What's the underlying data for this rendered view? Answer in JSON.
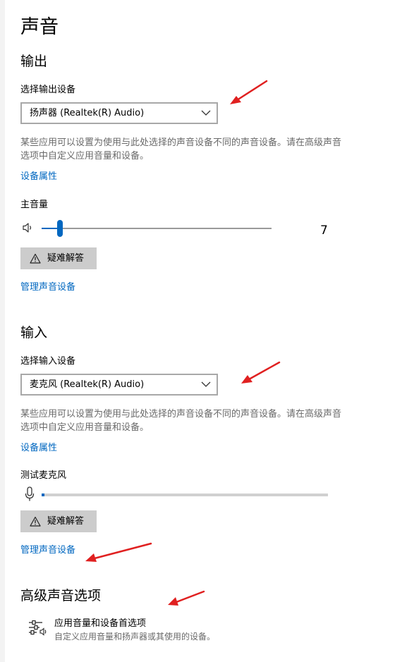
{
  "page": {
    "title": "声音"
  },
  "output": {
    "heading": "输出",
    "select_label": "选择输出设备",
    "device": "扬声器 (Realtek(R) Audio)",
    "description": "某些应用可以设置为使用与此处选择的声音设备不同的声音设备。请在高级声音选项中自定义应用音量和设备。",
    "device_properties_link": "设备属性",
    "volume_label": "主音量",
    "volume_value": "7",
    "volume_fraction": 0.07,
    "troubleshoot_label": "疑难解答",
    "manage_link": "管理声音设备"
  },
  "input": {
    "heading": "输入",
    "select_label": "选择输入设备",
    "device": "麦克风 (Realtek(R) Audio)",
    "description": "某些应用可以设置为使用与此处选择的声音设备不同的声音设备。请在高级声音选项中自定义应用音量和设备。",
    "device_properties_link": "设备属性",
    "test_label": "测试麦克风",
    "mic_level_fraction": 0.01,
    "troubleshoot_label": "疑难解答",
    "manage_link": "管理声音设备"
  },
  "advanced": {
    "heading": "高级声音选项",
    "app_volume_title": "应用音量和设备首选项",
    "app_volume_subtitle": "自定义应用音量和扬声器或其使用的设备。"
  },
  "colors": {
    "accent": "#0067c0",
    "annotation_arrow": "#e02020",
    "button_bg": "#cccccc"
  },
  "icons": {
    "dropdown": "chevron-down-icon",
    "speaker": "speaker-icon",
    "warning": "warning-icon",
    "microphone": "microphone-icon",
    "app_volume": "app-volume-sliders-icon"
  }
}
